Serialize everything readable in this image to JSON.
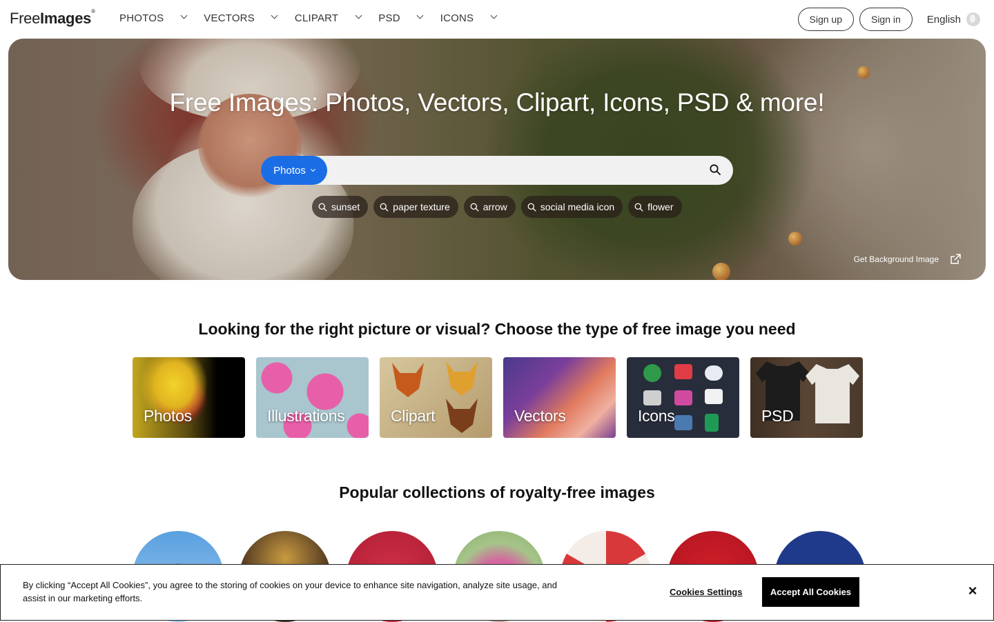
{
  "header": {
    "logo": {
      "part1": "Free",
      "part2": "Images",
      "mark": "®"
    },
    "nav": [
      {
        "label": "PHOTOS"
      },
      {
        "label": "VECTORS"
      },
      {
        "label": "CLIPART"
      },
      {
        "label": "PSD"
      },
      {
        "label": "ICONS"
      }
    ],
    "signup_label": "Sign up",
    "signin_label": "Sign in",
    "language": "English"
  },
  "hero": {
    "title": "Free Images: Photos, Vectors, Clipart, Icons, PSD & more!",
    "search_type": "Photos",
    "search_placeholder": "",
    "tags": [
      "sunset",
      "paper texture",
      "arrow",
      "social media icon",
      "flower"
    ],
    "bg_link": "Get Background Image"
  },
  "types_section": {
    "title": "Looking for the right picture or visual? Choose the type of free image you need",
    "cards": [
      "Photos",
      "Illustrations",
      "Clipart",
      "Vectors",
      "Icons",
      "PSD"
    ]
  },
  "collections_section": {
    "title": "Popular collections of royalty-free images"
  },
  "cookie": {
    "text": "By clicking “Accept All Cookies”, you agree to the storing of cookies on your device to enhance site navigation, analyze site usage, and assist in our marketing efforts.",
    "settings_label": "Cookies Settings",
    "accept_label": "Accept All Cookies",
    "close_label": "×"
  },
  "colors": {
    "accent": "#1b6de6",
    "cookie_button": "#000000"
  },
  "icons": [
    "chevron-down-icon",
    "globe-icon",
    "search-icon",
    "external-link-icon",
    "close-icon"
  ]
}
